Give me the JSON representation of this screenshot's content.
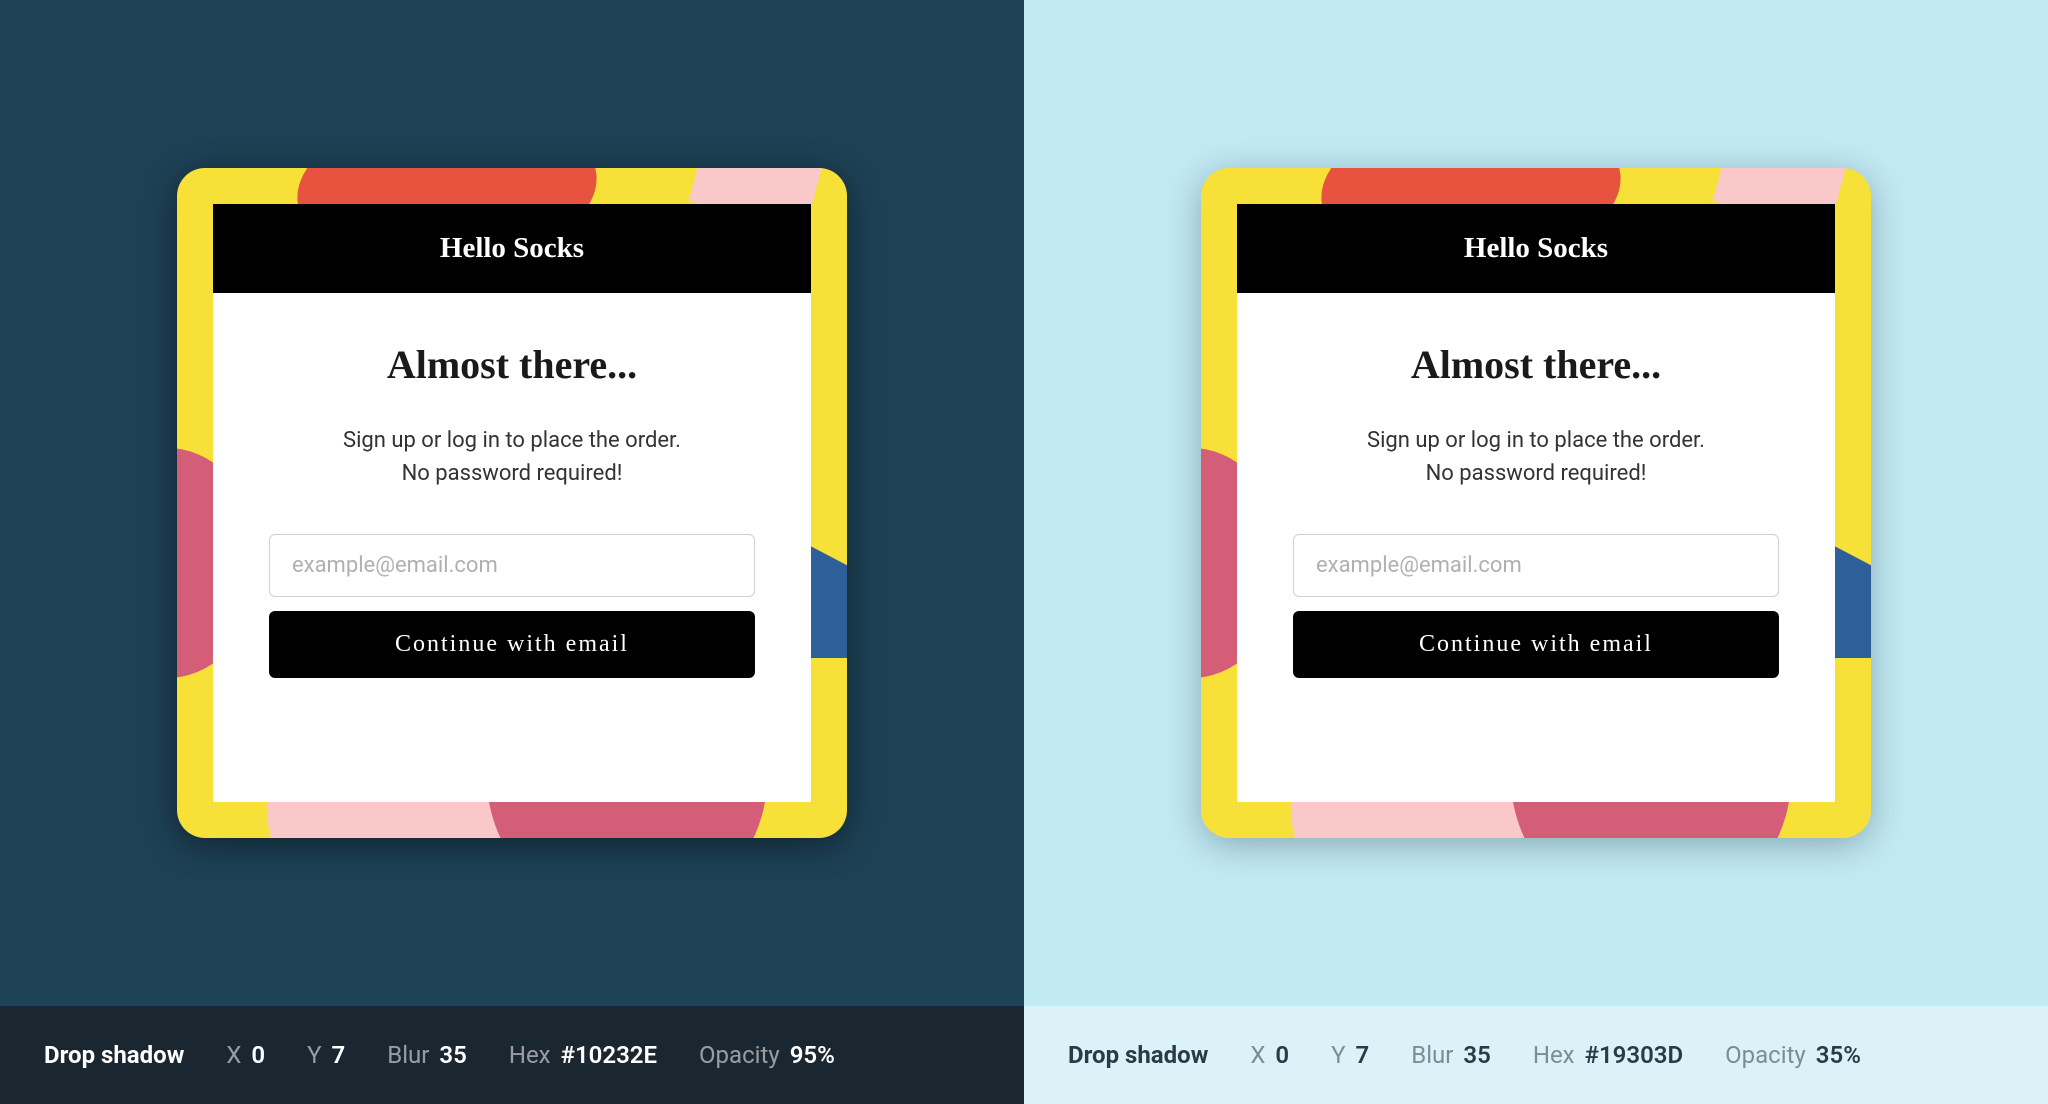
{
  "card": {
    "header": "Hello Socks",
    "title": "Almost there...",
    "subtitle_line1": "Sign up or log in to place the order.",
    "subtitle_line2": "No password required!",
    "email_placeholder": "example@email.com",
    "button_label": "Continue with email"
  },
  "footer": {
    "left": {
      "title": "Drop shadow",
      "x_label": "X",
      "x_value": "0",
      "y_label": "Y",
      "y_value": "7",
      "blur_label": "Blur",
      "blur_value": "35",
      "hex_label": "Hex",
      "hex_value": "#10232E",
      "opacity_label": "Opacity",
      "opacity_value": "95%"
    },
    "right": {
      "title": "Drop shadow",
      "x_label": "X",
      "x_value": "0",
      "y_label": "Y",
      "y_value": "7",
      "blur_label": "Blur",
      "blur_value": "35",
      "hex_label": "Hex",
      "hex_value": "#19303D",
      "opacity_label": "Opacity",
      "opacity_value": "35%"
    }
  }
}
